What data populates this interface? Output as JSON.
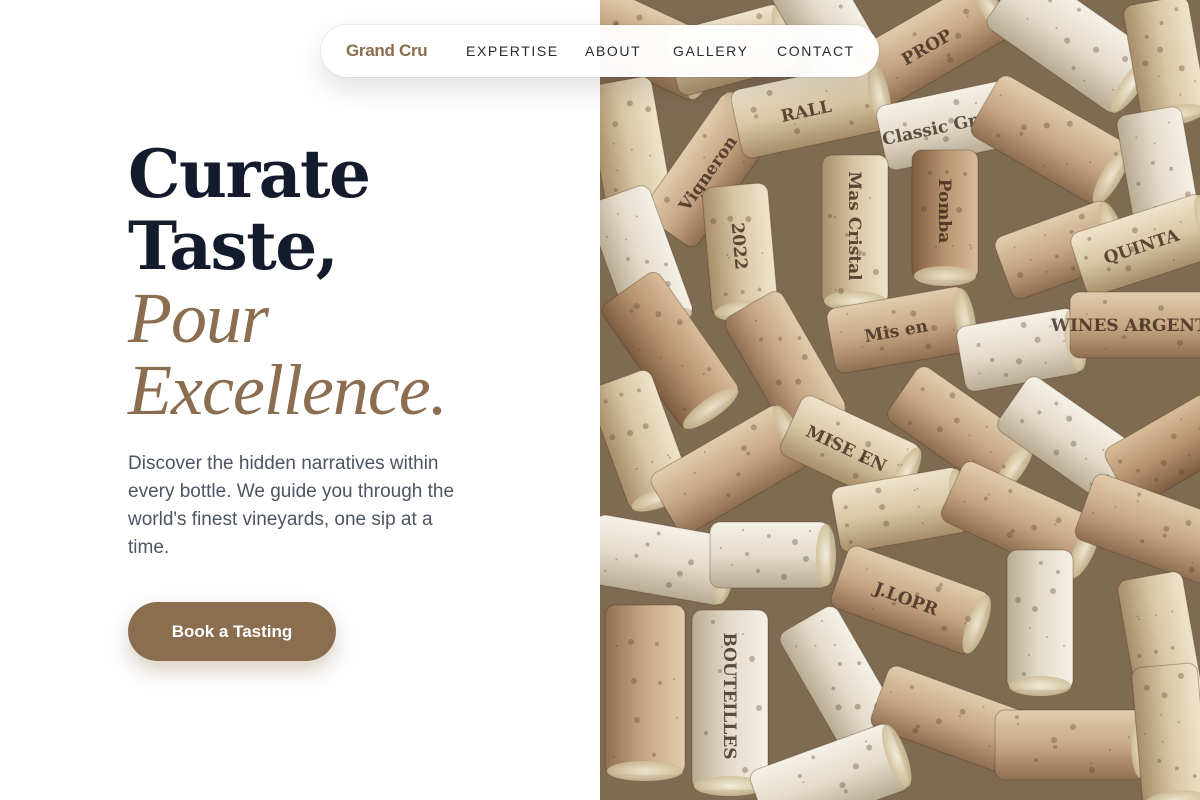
{
  "brand": {
    "name": "Grand Cru"
  },
  "nav": {
    "items": [
      {
        "label": "EXPERTISE"
      },
      {
        "label": "ABOUT"
      },
      {
        "label": "GALLERY"
      },
      {
        "label": "CONTACT"
      }
    ]
  },
  "hero": {
    "headline_line1": "Curate",
    "headline_line2": "Taste,",
    "headline_line3": "Pour",
    "headline_line4": "Excellence.",
    "description": "Discover the hidden narratives within every bottle. We guide you through the world's finest vineyards, one sip at a time.",
    "cta_label": "Book a Tasting"
  },
  "image": {
    "cork_labels": [
      "RALL",
      "PROP",
      "Mis en",
      "QUINTA",
      "MISE EN",
      "WINES ARGENTIN",
      "J.LOPR",
      "BOUTEILLES",
      "2022",
      "Pomba",
      "Vigneron",
      "Classic Green",
      "Mas Cristal"
    ]
  },
  "colors": {
    "accent": "#8b6d4f",
    "headline": "#141b2d",
    "body_text": "#4b5563",
    "nav_text": "#2b2b2b",
    "background": "#ffffff"
  }
}
